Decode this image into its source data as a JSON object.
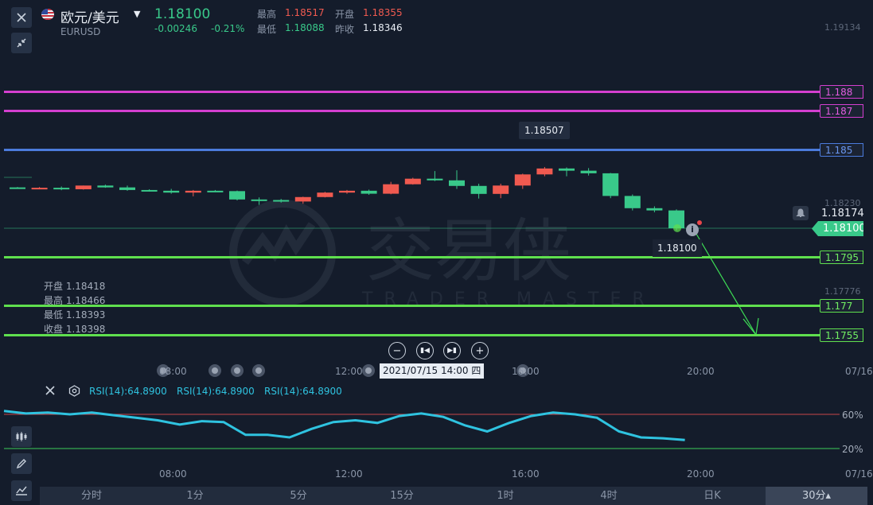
{
  "header": {
    "symbol_name": "欧元/美元",
    "symbol_code": "EURUSD",
    "last_price": "1.18100",
    "change": "-0.00246",
    "change_pct": "-0.21%",
    "high_label": "最高",
    "high_value": "1.18517",
    "open_label": "开盘",
    "open_value": "1.18355",
    "low_label": "最低",
    "low_value": "1.18088",
    "prev_close_label": "昨收",
    "prev_close_value": "1.18346"
  },
  "price_axis": {
    "ticks": [
      "1.19134",
      "1.18230",
      "1.17776"
    ],
    "alert_price": "1.18174",
    "current_price_label": "1.18100"
  },
  "levels": [
    {
      "label": "1.188",
      "color": "#d43fd0"
    },
    {
      "label": "1.187",
      "color": "#d43fd0"
    },
    {
      "label": "1.185",
      "color": "#4b7bdc"
    },
    {
      "label": "1.1795",
      "color": "#5fe04e"
    },
    {
      "label": "1.177",
      "color": "#5fe04e"
    },
    {
      "label": "1.1755",
      "color": "#5fe04e"
    }
  ],
  "chart": {
    "peak_label": "1.18507",
    "current_tag": "1.18100",
    "watermark_cn": "交易侠",
    "watermark_en": "TRADER MASTER",
    "candles": [
      {
        "o": 1.1832,
        "h": 1.18322,
        "l": 1.18318,
        "c": 1.18318
      },
      {
        "o": 1.18318,
        "h": 1.18322,
        "l": 1.18312,
        "c": 1.18318
      },
      {
        "o": 1.18318,
        "h": 1.18325,
        "l": 1.18305,
        "c": 1.1831
      },
      {
        "o": 1.1831,
        "h": 1.1833,
        "l": 1.18308,
        "c": 1.1833
      },
      {
        "o": 1.1833,
        "h": 1.18335,
        "l": 1.18318,
        "c": 1.1832
      },
      {
        "o": 1.1832,
        "h": 1.1833,
        "l": 1.18302,
        "c": 1.18306
      },
      {
        "o": 1.18306,
        "h": 1.1831,
        "l": 1.18298,
        "c": 1.18302
      },
      {
        "o": 1.18302,
        "h": 1.18312,
        "l": 1.18286,
        "c": 1.18292
      },
      {
        "o": 1.18292,
        "h": 1.18306,
        "l": 1.18272,
        "c": 1.18302
      },
      {
        "o": 1.18302,
        "h": 1.18306,
        "l": 1.18296,
        "c": 1.183
      },
      {
        "o": 1.183,
        "h": 1.18303,
        "l": 1.1825,
        "c": 1.18255
      },
      {
        "o": 1.18255,
        "h": 1.18266,
        "l": 1.18226,
        "c": 1.18252
      },
      {
        "o": 1.18252,
        "h": 1.18258,
        "l": 1.18238,
        "c": 1.18244
      },
      {
        "o": 1.18244,
        "h": 1.1827,
        "l": 1.18232,
        "c": 1.18268
      },
      {
        "o": 1.18268,
        "h": 1.18296,
        "l": 1.18266,
        "c": 1.18292
      },
      {
        "o": 1.18292,
        "h": 1.18306,
        "l": 1.18286,
        "c": 1.18302
      },
      {
        "o": 1.18302,
        "h": 1.18308,
        "l": 1.1828,
        "c": 1.18286
      },
      {
        "o": 1.18286,
        "h": 1.1835,
        "l": 1.18283,
        "c": 1.18337
      },
      {
        "o": 1.18337,
        "h": 1.18372,
        "l": 1.18335,
        "c": 1.18367
      },
      {
        "o": 1.18367,
        "h": 1.18408,
        "l": 1.18354,
        "c": 1.18358
      },
      {
        "o": 1.18358,
        "h": 1.18412,
        "l": 1.18312,
        "c": 1.18328
      },
      {
        "o": 1.18328,
        "h": 1.1834,
        "l": 1.1826,
        "c": 1.18285
      },
      {
        "o": 1.18285,
        "h": 1.1834,
        "l": 1.18262,
        "c": 1.1833
      },
      {
        "o": 1.1833,
        "h": 1.18394,
        "l": 1.18312,
        "c": 1.1839
      },
      {
        "o": 1.1839,
        "h": 1.1843,
        "l": 1.1838,
        "c": 1.18422
      },
      {
        "o": 1.18422,
        "h": 1.18428,
        "l": 1.1838,
        "c": 1.1841
      },
      {
        "o": 1.1841,
        "h": 1.18424,
        "l": 1.18384,
        "c": 1.18396
      },
      {
        "o": 1.18396,
        "h": 1.18398,
        "l": 1.18262,
        "c": 1.18274
      },
      {
        "o": 1.18274,
        "h": 1.18282,
        "l": 1.18196,
        "c": 1.18208
      },
      {
        "o": 1.18208,
        "h": 1.18218,
        "l": 1.18186,
        "c": 1.18196
      },
      {
        "o": 1.18196,
        "h": 1.18202,
        "l": 1.18088,
        "c": 1.181
      }
    ]
  },
  "ohlc_tooltip": {
    "open": "开盘 1.18418",
    "high": "最高 1.18466",
    "low": "最低 1.18393",
    "close": "收盘 1.18398"
  },
  "time_axis": {
    "ticks": [
      "08:00",
      "12:00",
      "16:00",
      "20:00",
      "07/16"
    ],
    "crosshair_time": "2021/07/15 14:00 四"
  },
  "rsi": {
    "labels": [
      "RSI(14):64.8900",
      "RSI(14):64.8900",
      "RSI(14):64.8900"
    ],
    "upper_label": "60%",
    "lower_label": "20%",
    "values": [
      64,
      61,
      62,
      60,
      62,
      59,
      56,
      53,
      48,
      52,
      51,
      36,
      36,
      33,
      43,
      51,
      53,
      50,
      58,
      61,
      57,
      47,
      40,
      50,
      58,
      62,
      60,
      56,
      40,
      33,
      32,
      30
    ]
  },
  "timeframes": {
    "items": [
      "分时",
      "1分",
      "5分",
      "15分",
      "1时",
      "4时",
      "日K",
      "30分▴"
    ],
    "active_index": 7
  },
  "colors": {
    "up": "#f05a50",
    "down": "#39c98a",
    "background": "#141c2b",
    "rsi_line": "#2fc3e0"
  }
}
